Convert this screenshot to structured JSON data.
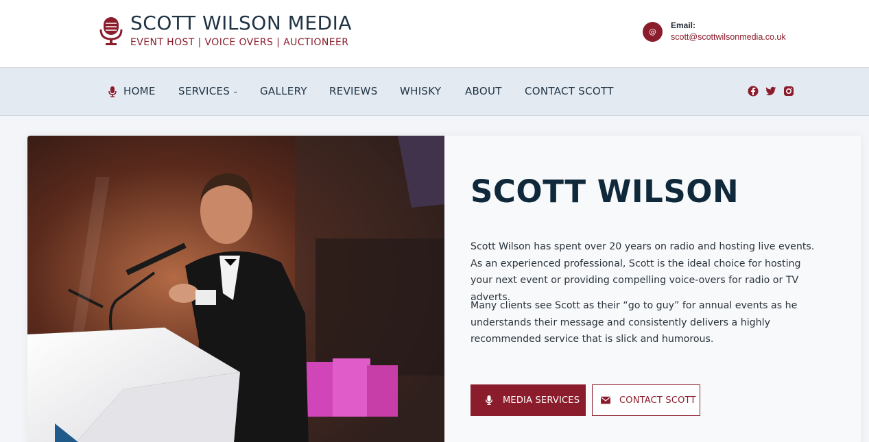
{
  "header": {
    "logo_title": "SCOTT WILSON MEDIA",
    "logo_subtitle": "EVENT HOST | VOICE OVERS | AUCTIONEER",
    "email_label": "Email:",
    "email_value": "scott@scottwilsonmedia.co.uk",
    "email_icon_text": "@"
  },
  "nav": {
    "items": [
      {
        "label": "HOME",
        "icon": "microphone-icon"
      },
      {
        "label": "SERVICES",
        "has_dropdown": true
      },
      {
        "label": "GALLERY"
      },
      {
        "label": "REVIEWS"
      },
      {
        "label": "WHISKY"
      },
      {
        "label": "ABOUT"
      },
      {
        "label": "CONTACT SCOTT"
      }
    ],
    "dropdown_glyph": "⌄",
    "social": [
      "facebook-icon",
      "twitter-icon",
      "instagram-icon"
    ]
  },
  "hero": {
    "title": "SCOTT WILSON",
    "paragraph1": "Scott Wilson has spent over 20 years on radio and hosting live events. As an experienced professional, Scott is the ideal choice for hosting your next event or providing compelling voice-overs for radio or TV adverts.",
    "paragraph2": "Many clients see Scott as their “go to guy” for annual events as he understands their message and consistently delivers a highly recommended service that is slick and humorous.",
    "button_primary": "MEDIA SERVICES",
    "button_secondary": "CONTACT SCOTT"
  },
  "colors": {
    "brand_red": "#8b1c2b",
    "navy": "#10293a",
    "nav_bg": "#e3eaf2"
  }
}
